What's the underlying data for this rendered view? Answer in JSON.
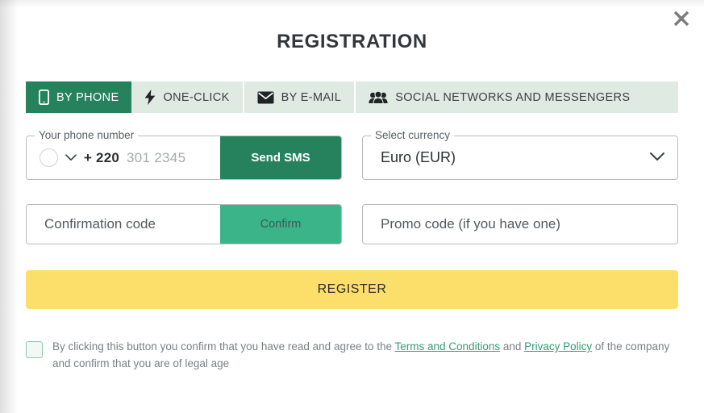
{
  "dialog": {
    "title": "REGISTRATION",
    "close_icon": "close-icon"
  },
  "tabs": [
    {
      "label": "BY PHONE",
      "icon": "mobile-phone-icon",
      "active": true
    },
    {
      "label": "ONE-CLICK",
      "icon": "lightning-bolt-icon",
      "active": false
    },
    {
      "label": "BY E-MAIL",
      "icon": "envelope-icon",
      "active": false
    },
    {
      "label": "SOCIAL NETWORKS AND MESSENGERS",
      "icon": "people-group-icon",
      "active": false
    }
  ],
  "phone_field": {
    "legend": "Your phone number",
    "country_flag": "gambia-flag-icon",
    "dial_code": "+ 220",
    "placeholder": "301 2345",
    "value": "",
    "send_sms_label": "Send SMS"
  },
  "currency_field": {
    "legend": "Select currency",
    "selected": "Euro (EUR)",
    "chevron_icon": "chevron-down-icon"
  },
  "confirmation_field": {
    "placeholder": "Confirmation code",
    "value": "",
    "confirm_label": "Confirm"
  },
  "promo_field": {
    "placeholder": "Promo code (if you have one)",
    "value": ""
  },
  "register_button": {
    "label": "REGISTER"
  },
  "terms": {
    "checked": false,
    "text_before": "By clicking this button you confirm that you have read and agree to the ",
    "link_terms": "Terms and Conditions",
    "text_between": " and ",
    "link_privacy": "Privacy Policy",
    "text_after": " of the company and confirm that you are of legal age"
  },
  "colors": {
    "primary_green": "#25825c",
    "secondary_green": "#3cb489",
    "tab_inactive_bg": "#dfeae2",
    "register_yellow": "#fcdf6a",
    "link_green": "#2f9f74",
    "title_text": "#32373c"
  }
}
